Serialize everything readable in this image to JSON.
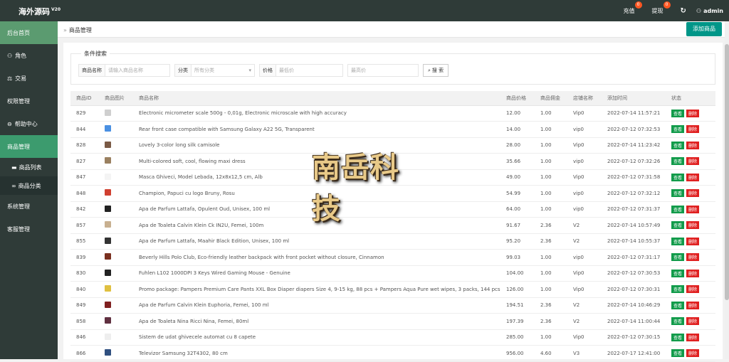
{
  "header": {
    "brand": "海外源码",
    "version": "V20",
    "recharge": "充值",
    "recharge_badge": "0",
    "withdraw": "提现",
    "withdraw_badge": "0",
    "refresh_icon": "↻",
    "user": "admin"
  },
  "sidebar": {
    "items": [
      {
        "label": "后台首页"
      },
      {
        "label": "角色"
      },
      {
        "label": "交易"
      },
      {
        "label": "权限管理"
      },
      {
        "label": "帮助中心"
      },
      {
        "label": "商品管理"
      },
      {
        "label": "系统管理"
      },
      {
        "label": "客服管理"
      }
    ],
    "sub": [
      {
        "label": "商品列表"
      },
      {
        "label": "商品分类"
      }
    ]
  },
  "breadcrumb": "商品管理",
  "add_button": "添加商品",
  "search": {
    "legend": "条件搜索",
    "name_label": "商品名称",
    "name_placeholder": "请输入商品名称",
    "cat_label": "分类",
    "cat_placeholder": "所有分类",
    "price_label": "价格",
    "min_placeholder": "最低价",
    "max_placeholder": "最高价",
    "button": "搜 索"
  },
  "table": {
    "headers": [
      "商品ID",
      "商品图片",
      "商品名称",
      "商品价格",
      "商品佣金",
      "店铺名称",
      "添加时间",
      "状态"
    ],
    "view_label": "查看",
    "delete_label": "删除",
    "rows": [
      [
        "829",
        "Electronic micrometer scale 500g - 0,01g, Electronic microscale with high accuracy",
        "12.00",
        "1.00",
        "Vip0",
        "2022-07-14 11:57:21"
      ],
      [
        "844",
        "Rear front case compatible with Samsung Galaxy A22 5G, Transparent",
        "14.00",
        "1.00",
        "vip0",
        "2022-07-12 07:32:53"
      ],
      [
        "828",
        "Lovely 3-color long silk camisole",
        "28.00",
        "1.00",
        "Vip0",
        "2022-07-14 11:23:42"
      ],
      [
        "827",
        "Multi-colored soft, cool, flowing maxi dress",
        "35.66",
        "1.00",
        "vip0",
        "2022-07-12 07:32:26"
      ],
      [
        "847",
        "Masca Ghiveci, Model Lebada, 12x8x12,5 cm, Alb",
        "49.00",
        "1.00",
        "Vip0",
        "2022-07-12 07:31:58"
      ],
      [
        "848",
        "Champion, Papuci cu logo Bruny, Rosu",
        "54.99",
        "1.00",
        "vip0",
        "2022-07-12 07:32:12"
      ],
      [
        "842",
        "Apa de Parfum Lattafa, Opulent Oud, Unisex, 100 ml",
        "64.00",
        "1.00",
        "vip0",
        "2022-07-12 07:31:37"
      ],
      [
        "857",
        "Apa de Toaleta Calvin Klein Ck IN2U, Femei, 100m",
        "91.67",
        "2.36",
        "V2",
        "2022-07-14 10:57:49"
      ],
      [
        "855",
        "Apa de Parfum Lattafa, Maahir Black Edition, Unisex, 100 ml",
        "95.20",
        "2.36",
        "V2",
        "2022-07-14 10:55:37"
      ],
      [
        "839",
        "Beverly Hills Polo Club, Eco-friendly leather backpack with front pocket without closure, Cinnamon",
        "99.03",
        "1.00",
        "vip0",
        "2022-07-12 07:31:17"
      ],
      [
        "830",
        "Fuhlen L102 1000DPI 3 Keys Wired Gaming Mouse - Genuine",
        "104.00",
        "1.00",
        "Vip0",
        "2022-07-12 07:30:53"
      ],
      [
        "840",
        "Promo package: Pampers Premium Care Pants XXL Box Diaper diapers Size 4, 9-15 kg, 88 pcs + Pampers Aqua Pure wet wipes, 3 packs, 144 pcs",
        "126.00",
        "1.00",
        "Vip0",
        "2022-07-12 07:30:31"
      ],
      [
        "849",
        "Apa de Parfum Calvin Klein Euphoria, Femei, 100 ml",
        "194.51",
        "2.36",
        "V2",
        "2022-07-14 10:46:29"
      ],
      [
        "858",
        "Apa de Toaleta Nina Ricci Nina, Femei, 80ml",
        "197.39",
        "2.36",
        "V2",
        "2022-07-14 11:00:44"
      ],
      [
        "846",
        "Sistem de udat ghivecele automat cu 8 capete",
        "285.00",
        "1.00",
        "Vip0",
        "2022-07-12 07:30:15"
      ],
      [
        "866",
        "Televizor Samsung 32T4302, 80 cm",
        "956.00",
        "4.60",
        "V3",
        "2022-07-17 12:41:00"
      ]
    ]
  },
  "watermark": "南岳科技",
  "colors": {
    "sidebar": "#2f3b38",
    "active": "#3c9b6e",
    "primary": "#009688",
    "view": "#119b4a",
    "delete": "#e02020"
  }
}
